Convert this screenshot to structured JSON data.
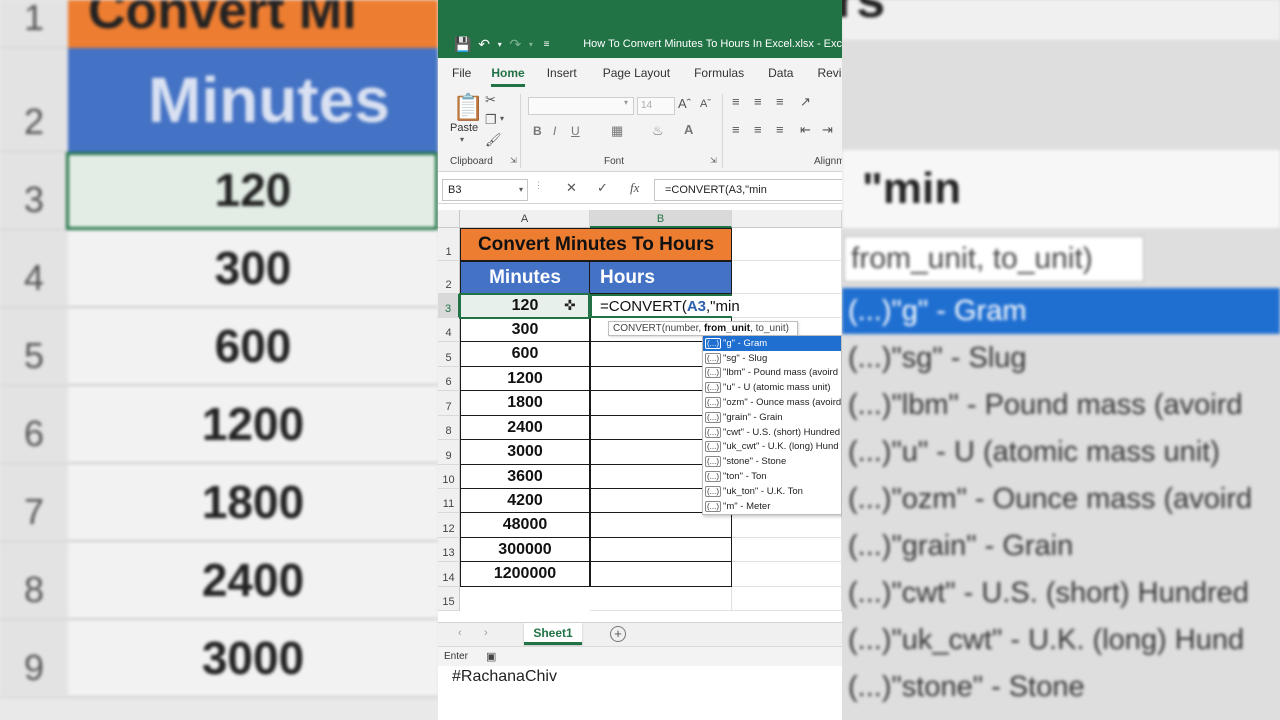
{
  "window": {
    "title": "How To Convert Minutes To Hours In Excel.xlsx  -  Exc"
  },
  "tabs": [
    "File",
    "Home",
    "Insert",
    "Page Layout",
    "Formulas",
    "Data",
    "Revie"
  ],
  "ribbon": {
    "clipboard_label": "Clipboard",
    "paste_label": "Paste",
    "font_label": "Font",
    "font_size": "14",
    "alignment_label": "Alignm"
  },
  "formula_bar": {
    "name_box": "B3",
    "formula": "=CONVERT(A3,\"min"
  },
  "grid": {
    "columns": [
      "A",
      "B"
    ],
    "rows": [
      "1",
      "2",
      "3",
      "4",
      "5",
      "6",
      "7",
      "8",
      "9",
      "10",
      "11",
      "12",
      "13",
      "14",
      "15"
    ],
    "title": "Convert Minutes To Hours",
    "header_a": "Minutes",
    "header_b": "Hours",
    "values": [
      "120",
      "300",
      "600",
      "1200",
      "1800",
      "2400",
      "3000",
      "3600",
      "4200",
      "48000",
      "300000",
      "1200000"
    ],
    "edit": {
      "prefix": "=CONVERT(",
      "ref": "A3",
      "suffix": ",\"min"
    },
    "tooltip": {
      "fn": "CONVERT(number, ",
      "arg": "from_unit",
      "rest": ", to_unit)"
    },
    "autocomplete": [
      "\"g\" - Gram",
      "\"sg\" - Slug",
      "\"lbm\" - Pound mass (avoird",
      "\"u\" - U (atomic mass unit)",
      "\"ozm\" - Ounce mass (avoird",
      "\"grain\" - Grain",
      "\"cwt\" - U.S. (short) Hundred",
      "\"uk_cwt\" - U.K. (long) Hund",
      "\"stone\" - Stone",
      "\"ton\" - Ton",
      "\"uk_ton\" - U.K. Ton",
      "\"m\" - Meter"
    ],
    "ac_tag": "(...)"
  },
  "sheet": {
    "tab": "Sheet1"
  },
  "status": {
    "mode": "Enter"
  },
  "overlay": {
    "hashtag": "#RachanaChiv"
  },
  "background": {
    "left_rows": [
      "1",
      "2",
      "3",
      "4",
      "5",
      "6",
      "7",
      "8",
      "9"
    ],
    "left_title": "Convert Mi",
    "left_header": "Minutes",
    "left_values": [
      "120",
      "300",
      "600",
      "1200",
      "1800",
      "2400",
      "3000"
    ],
    "right_title_tail": "rs",
    "right_formula": "\"min",
    "right_tip": "from_unit, to_unit)",
    "right_items": [
      "(...)\"g\" - Gram",
      "(...)\"sg\" - Slug",
      "(...)\"lbm\" - Pound mass (avoird",
      "(...)\"u\" - U (atomic mass unit)",
      "(...)\"ozm\" - Ounce mass (avoird",
      "(...)\"grain\" - Grain",
      "(...)\"cwt\" - U.S. (short) Hundred",
      "(...)\"uk_cwt\" - U.K. (long) Hund",
      "(...)\"stone\" - Stone"
    ]
  },
  "colors": {
    "excel_green": "#217346",
    "title_orange": "#ed7d31",
    "header_blue": "#4472c4",
    "highlight_blue": "#1f6fd1"
  }
}
